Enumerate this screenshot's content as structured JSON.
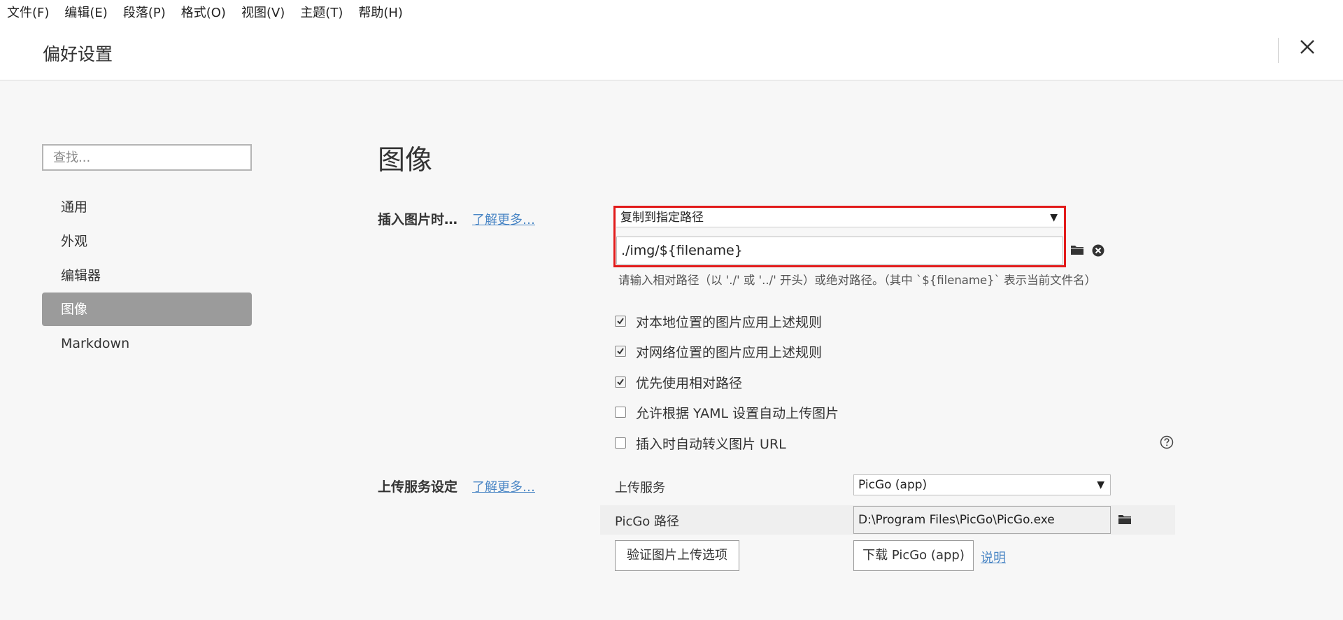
{
  "menubar": {
    "items": [
      "文件(F)",
      "编辑(E)",
      "段落(P)",
      "格式(O)",
      "视图(V)",
      "主题(T)",
      "帮助(H)"
    ]
  },
  "header": {
    "title": "偏好设置"
  },
  "sidebar": {
    "search_placeholder": "查找...",
    "items": [
      {
        "label": "通用"
      },
      {
        "label": "外观"
      },
      {
        "label": "编辑器"
      },
      {
        "label": "图像"
      },
      {
        "label": "Markdown"
      }
    ],
    "active_index": 3
  },
  "main": {
    "title": "图像",
    "insert_image": {
      "label": "插入图片时…",
      "learn_more": "了解更多…",
      "action_selected": "复制到指定路径",
      "path_value": "./img/${filename}",
      "hint": "请输入相对路径（以 './' 或 '../' 开头）或绝对路径。（其中 `${filename}` 表示当前文件名）"
    },
    "options": [
      {
        "label": "对本地位置的图片应用上述规则",
        "checked": true
      },
      {
        "label": "对网络位置的图片应用上述规则",
        "checked": true
      },
      {
        "label": "优先使用相对路径",
        "checked": true
      },
      {
        "label": "允许根据 YAML 设置自动上传图片",
        "checked": false
      },
      {
        "label": "插入时自动转义图片 URL",
        "checked": false
      }
    ],
    "upload": {
      "label": "上传服务设定",
      "learn_more": "了解更多…",
      "service_label": "上传服务",
      "service_selected": "PicGo (app)",
      "path_label": "PicGo 路径",
      "path_value": "D:\\Program Files\\PicGo\\PicGo.exe",
      "verify_button": "验证图片上传选项",
      "download_button": "下载 PicGo (app)",
      "docs_link": "说明"
    }
  },
  "colors": {
    "accent_red": "#e21b1b",
    "link_blue": "#4a86c5",
    "active_nav": "#9b9b9b"
  }
}
